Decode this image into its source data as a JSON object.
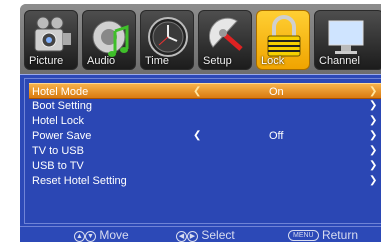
{
  "tabs": [
    {
      "label": "Picture",
      "icon": "camera-icon"
    },
    {
      "label": "Audio",
      "icon": "music-note-icon"
    },
    {
      "label": "Time",
      "icon": "clock-icon"
    },
    {
      "label": "Setup",
      "icon": "satellite-dish-icon"
    },
    {
      "label": "Lock",
      "icon": "padlock-icon",
      "active": true
    },
    {
      "label": "Channel",
      "icon": "monitor-icon"
    }
  ],
  "menu": {
    "items": [
      {
        "label": "Hotel Mode",
        "value": "On",
        "selected": true
      },
      {
        "label": "Boot Setting"
      },
      {
        "label": "Hotel Lock"
      },
      {
        "label": "Power Save",
        "value": "Off"
      },
      {
        "label": "TV to USB"
      },
      {
        "label": "USB to TV"
      },
      {
        "label": "Reset Hotel Setting"
      }
    ]
  },
  "footer": {
    "move_label": "Move",
    "select_label": "Select",
    "menu_key": "MENU",
    "return_label": "Return"
  },
  "colors": {
    "menu_bg": "#2c49b7",
    "highlight": "#f0a400",
    "tab_bg": "#7a7a7a"
  }
}
